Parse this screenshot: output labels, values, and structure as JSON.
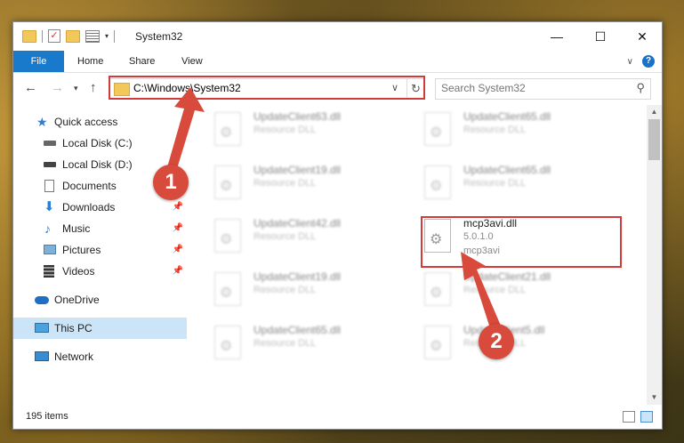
{
  "window": {
    "title": "System32"
  },
  "ribbon": {
    "tabs": [
      "File",
      "Home",
      "Share",
      "View"
    ],
    "help": "?"
  },
  "nav": {
    "address": "C:\\Windows\\System32",
    "search_placeholder": "Search System32"
  },
  "sidebar": {
    "items": [
      {
        "label": "Quick access",
        "icon": "star-icon",
        "pinned": false
      },
      {
        "label": "Local Disk (C:)",
        "icon": "drive-icon",
        "pinned": false
      },
      {
        "label": "Local Disk (D:)",
        "icon": "drive-icon",
        "pinned": false
      },
      {
        "label": "Documents",
        "icon": "document-icon",
        "pinned": false
      },
      {
        "label": "Downloads",
        "icon": "download-icon",
        "pinned": true
      },
      {
        "label": "Music",
        "icon": "music-icon",
        "pinned": true
      },
      {
        "label": "Pictures",
        "icon": "pictures-icon",
        "pinned": true
      },
      {
        "label": "Videos",
        "icon": "videos-icon",
        "pinned": true
      },
      {
        "label": "OneDrive",
        "icon": "cloud-icon",
        "pinned": false
      },
      {
        "label": "This PC",
        "icon": "computer-icon",
        "pinned": false,
        "selected": true
      },
      {
        "label": "Network",
        "icon": "network-icon",
        "pinned": false
      }
    ]
  },
  "files": [
    {
      "name": "UpdateClient63.dll",
      "type": "Resource DLL"
    },
    {
      "name": "UpdateClient65.dll",
      "type": "Resource DLL"
    },
    {
      "name": "UpdateClient19.dll",
      "type": "Resource DLL"
    },
    {
      "name": "UpdateClient65.dll",
      "type": "Resource DLL"
    },
    {
      "name": "UpdateClient42.dll",
      "type": "Resource DLL"
    },
    {
      "name": "mcp3avi.dll",
      "type": "5.0.1.0",
      "desc": "mcp3avi"
    },
    {
      "name": "UpdateClient19.dll",
      "type": "Resource DLL"
    },
    {
      "name": "UpdateClient21.dll",
      "type": "Resource DLL"
    },
    {
      "name": "UpdateClient65.dll",
      "type": "Resource DLL"
    },
    {
      "name": "UpdateClient5.dll",
      "type": "Resource DLL"
    }
  ],
  "status": {
    "count": "195 items"
  },
  "annotations": {
    "step1": "1",
    "step2": "2"
  },
  "colors": {
    "accent": "#1979ca",
    "highlight": "#d33a3a",
    "selected": "#cce4f7"
  }
}
